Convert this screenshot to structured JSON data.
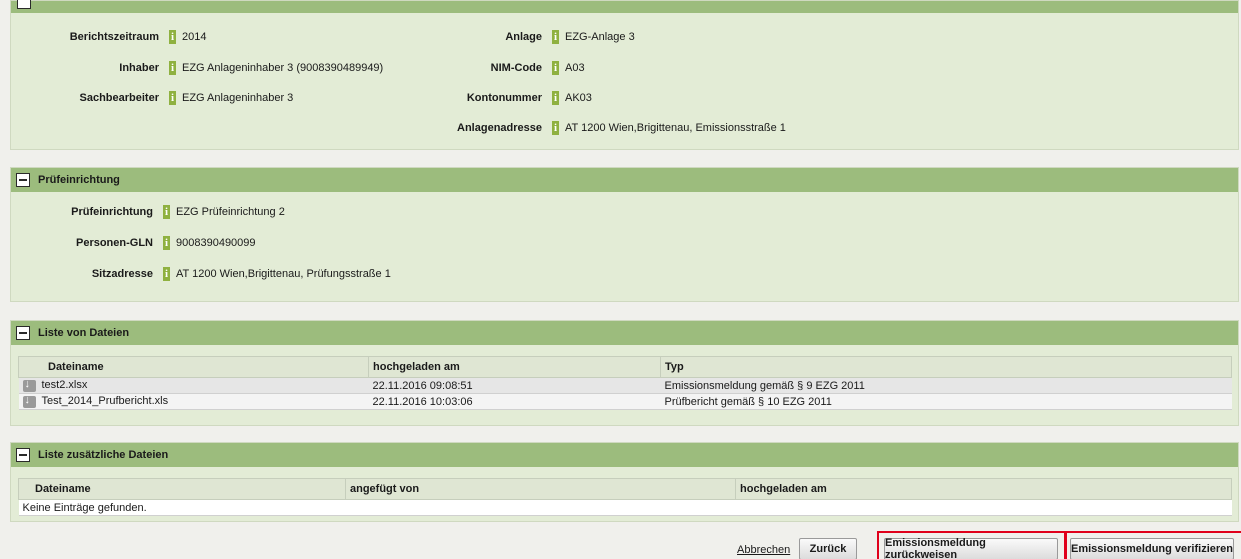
{
  "anlage": {
    "berichtszeitraum_label": "Berichtszeitraum",
    "berichtszeitraum_value": "2014",
    "inhaber_label": "Inhaber",
    "inhaber_value": "EZG Anlageninhaber 3 (9008390489949)",
    "sachbearbeiter_label": "Sachbearbeiter",
    "sachbearbeiter_value": "EZG Anlageninhaber 3",
    "anlage_label": "Anlage",
    "anlage_value": "EZG-Anlage 3",
    "nim_label": "NIM-Code",
    "nim_value": "A03",
    "konto_label": "Kontonummer",
    "konto_value": "AK03",
    "adresse_label": "Anlagenadresse",
    "adresse_value": "AT 1200 Wien,Brigittenau, Emissionsstraße 1"
  },
  "pruef": {
    "title": "Prüfeinrichtung",
    "einrichtung_label": "Prüfeinrichtung",
    "einrichtung_value": "EZG Prüfeinrichtung 2",
    "gln_label": "Personen-GLN",
    "gln_value": "9008390490099",
    "sitz_label": "Sitzadresse",
    "sitz_value": "AT 1200 Wien,Brigittenau, Prüfungsstraße 1"
  },
  "dateien": {
    "title": "Liste von Dateien",
    "headers": [
      "Dateiname",
      "hochgeladen am",
      "Typ"
    ],
    "rows": [
      [
        "test2.xlsx",
        "22.11.2016 09:08:51",
        "Emissionsmeldung gemäß § 9 EZG 2011"
      ],
      [
        "Test_2014_Prufbericht.xls",
        "22.11.2016 10:03:06",
        "Prüfbericht gemäß § 10 EZG 2011"
      ]
    ]
  },
  "zusatz": {
    "title": "Liste zusätzliche Dateien",
    "headers": [
      "Dateiname",
      "angefügt von",
      "hochgeladen am"
    ],
    "empty": "Keine Einträge gefunden."
  },
  "actions": {
    "abbrechen": "Abbrechen",
    "zurueck": "Zurück",
    "zurueckweisen": "Emissionsmeldung zurückweisen",
    "verifizieren": "Emissionsmeldung verifizieren"
  },
  "colors": {
    "highlight": "#e0001b",
    "header_green": "#9cbc7d",
    "panel_bg": "#e3ecd6",
    "info_green": "#8fb140"
  },
  "icons": {
    "info": "info-icon",
    "toggle": "collapse-toggle-icon",
    "download": "download-icon"
  }
}
